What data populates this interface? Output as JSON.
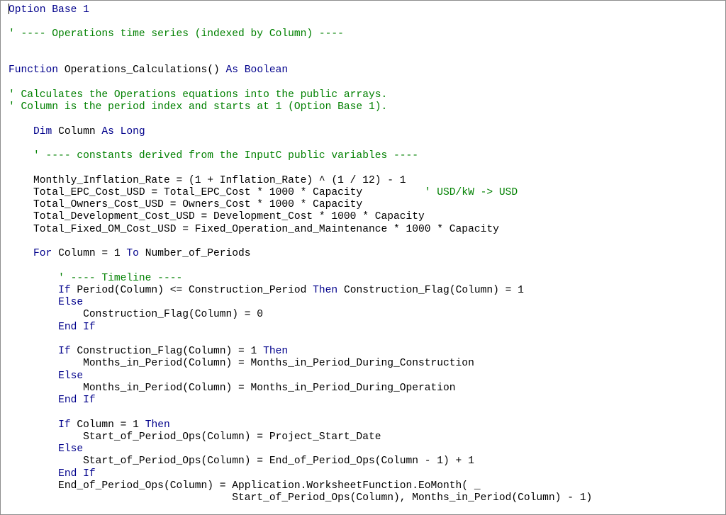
{
  "editor": {
    "lines": [
      [
        {
          "t": "Option Base 1",
          "c": "kw"
        }
      ],
      [],
      [
        {
          "t": "' ---- Operations time series (indexed by Column) ----",
          "c": "cm"
        }
      ],
      [],
      [],
      [
        {
          "t": "Function ",
          "c": "kw"
        },
        {
          "t": "Operations_Calculations() ",
          "c": ""
        },
        {
          "t": "As Boolean",
          "c": "kw"
        }
      ],
      [],
      [
        {
          "t": "' Calculates the Operations equations into the public arrays.",
          "c": "cm"
        }
      ],
      [
        {
          "t": "' Column is the period index and starts at 1 (Option Base 1).",
          "c": "cm"
        }
      ],
      [],
      [
        {
          "t": "    ",
          "c": ""
        },
        {
          "t": "Dim ",
          "c": "kw"
        },
        {
          "t": "Column ",
          "c": ""
        },
        {
          "t": "As Long",
          "c": "kw"
        }
      ],
      [],
      [
        {
          "t": "    ",
          "c": ""
        },
        {
          "t": "' ---- constants derived from the InputC public variables ----",
          "c": "cm"
        }
      ],
      [],
      [
        {
          "t": "    Monthly_Inflation_Rate = (1 + Inflation_Rate) ^ (1 / 12) - 1",
          "c": ""
        }
      ],
      [
        {
          "t": "    Total_EPC_Cost_USD = Total_EPC_Cost * 1000 * Capacity          ",
          "c": ""
        },
        {
          "t": "' USD/kW -> USD",
          "c": "cm"
        }
      ],
      [
        {
          "t": "    Total_Owners_Cost_USD = Owners_Cost * 1000 * Capacity",
          "c": ""
        }
      ],
      [
        {
          "t": "    Total_Development_Cost_USD = Development_Cost * 1000 * Capacity",
          "c": ""
        }
      ],
      [
        {
          "t": "    Total_Fixed_OM_Cost_USD = Fixed_Operation_and_Maintenance * 1000 * Capacity",
          "c": ""
        }
      ],
      [],
      [
        {
          "t": "    ",
          "c": ""
        },
        {
          "t": "For ",
          "c": "kw"
        },
        {
          "t": "Column = 1 ",
          "c": ""
        },
        {
          "t": "To ",
          "c": "kw"
        },
        {
          "t": "Number_of_Periods",
          "c": ""
        }
      ],
      [],
      [
        {
          "t": "        ",
          "c": ""
        },
        {
          "t": "' ---- Timeline ----",
          "c": "cm"
        }
      ],
      [
        {
          "t": "        ",
          "c": ""
        },
        {
          "t": "If ",
          "c": "kw"
        },
        {
          "t": "Period(Column) <= Construction_Period ",
          "c": ""
        },
        {
          "t": "Then ",
          "c": "kw"
        },
        {
          "t": "Construction_Flag(Column) = 1",
          "c": ""
        }
      ],
      [
        {
          "t": "        ",
          "c": ""
        },
        {
          "t": "Else",
          "c": "kw"
        }
      ],
      [
        {
          "t": "            Construction_Flag(Column) = 0",
          "c": ""
        }
      ],
      [
        {
          "t": "        ",
          "c": ""
        },
        {
          "t": "End If",
          "c": "kw"
        }
      ],
      [],
      [
        {
          "t": "        ",
          "c": ""
        },
        {
          "t": "If ",
          "c": "kw"
        },
        {
          "t": "Construction_Flag(Column) = 1 ",
          "c": ""
        },
        {
          "t": "Then",
          "c": "kw"
        }
      ],
      [
        {
          "t": "            Months_in_Period(Column) = Months_in_Period_During_Construction",
          "c": ""
        }
      ],
      [
        {
          "t": "        ",
          "c": ""
        },
        {
          "t": "Else",
          "c": "kw"
        }
      ],
      [
        {
          "t": "            Months_in_Period(Column) = Months_in_Period_During_Operation",
          "c": ""
        }
      ],
      [
        {
          "t": "        ",
          "c": ""
        },
        {
          "t": "End If",
          "c": "kw"
        }
      ],
      [],
      [
        {
          "t": "        ",
          "c": ""
        },
        {
          "t": "If ",
          "c": "kw"
        },
        {
          "t": "Column = 1 ",
          "c": ""
        },
        {
          "t": "Then",
          "c": "kw"
        }
      ],
      [
        {
          "t": "            Start_of_Period_Ops(Column) = Project_Start_Date",
          "c": ""
        }
      ],
      [
        {
          "t": "        ",
          "c": ""
        },
        {
          "t": "Else",
          "c": "kw"
        }
      ],
      [
        {
          "t": "            Start_of_Period_Ops(Column) = End_of_Period_Ops(Column - 1) + 1",
          "c": ""
        }
      ],
      [
        {
          "t": "        ",
          "c": ""
        },
        {
          "t": "End If",
          "c": "kw"
        }
      ],
      [
        {
          "t": "        End_of_Period_Ops(Column) = Application.WorksheetFunction.EoMonth( _",
          "c": ""
        }
      ],
      [
        {
          "t": "                                    Start_of_Period_Ops(Column), Months_in_Period(Column) - 1)",
          "c": ""
        }
      ]
    ]
  }
}
